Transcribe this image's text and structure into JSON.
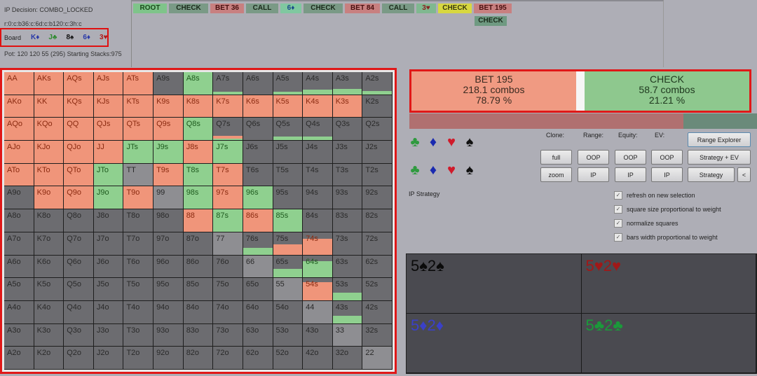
{
  "info": {
    "decision": "IP Decision:  COMBO_LOCKED",
    "line": "r:0:c:b36:c:6d:c:b120:c:3h:c",
    "pot": "Pot: 120 120 55 (295) Starting Stacks:975"
  },
  "board": {
    "label": "Board",
    "cards": [
      {
        "text": "K♦",
        "color": "#2a3aa8"
      },
      {
        "text": "J♣",
        "color": "#2e8a2e"
      },
      {
        "text": "8♠",
        "color": "#111111"
      },
      {
        "text": "6♦",
        "color": "#2a3aa8"
      },
      {
        "text": "3♥",
        "color": "#b01a1a"
      }
    ]
  },
  "tree": {
    "nodes": [
      {
        "label": "ROOT",
        "bg": "#7fc48a",
        "fg": "#1a4a1a"
      },
      {
        "label": "CHECK",
        "bg": "#7a9a86",
        "fg": "#1a2a1a"
      },
      {
        "label": "BET 36",
        "bg": "#c88080",
        "fg": "#4a1010"
      },
      {
        "label": "CALL",
        "bg": "#7a9a86",
        "fg": "#1a2a1a"
      },
      {
        "label": "6♦",
        "bg": "#80c8a0",
        "fg": "#1a4a8a"
      },
      {
        "label": "CHECK",
        "bg": "#7a9a86",
        "fg": "#1a2a1a"
      },
      {
        "label": "BET 84",
        "bg": "#c88080",
        "fg": "#4a1010"
      },
      {
        "label": "CALL",
        "bg": "#7a9a86",
        "fg": "#1a2a1a"
      },
      {
        "label": "3♥",
        "bg": "#80b890",
        "fg": "#8a2020"
      },
      {
        "label": "CHECK",
        "bg": "#d8d840",
        "fg": "#3a3a10"
      },
      {
        "label": "BET 195",
        "bg": "#c88080",
        "fg": "#4a1010"
      }
    ],
    "child": {
      "label": "CHECK",
      "bg": "#6f9a82",
      "fg": "#1a2a1a"
    }
  },
  "colors": {
    "bet": "#f0957a",
    "check": "#8fd08f",
    "empty": "#6c6c70",
    "pair_empty": "#8e8e92"
  },
  "grid": {
    "ranks": [
      "A",
      "K",
      "Q",
      "J",
      "T",
      "9",
      "8",
      "7",
      "6",
      "5",
      "4",
      "3",
      "2"
    ],
    "cells": [
      [
        {
          "h": "AA",
          "b": 1,
          "c": 0
        },
        {
          "h": "AKs",
          "b": 1,
          "c": 0
        },
        {
          "h": "AQs",
          "b": 1,
          "c": 0
        },
        {
          "h": "AJs",
          "b": 1,
          "c": 0
        },
        {
          "h": "ATs",
          "b": 1,
          "c": 0
        },
        {
          "h": "A9s",
          "b": 0,
          "c": 0
        },
        {
          "h": "A8s",
          "b": 0,
          "c": 1
        },
        {
          "h": "A7s",
          "b": 0,
          "c": 0.12
        },
        {
          "h": "A6s",
          "b": 0,
          "c": 0
        },
        {
          "h": "A5s",
          "b": 0,
          "c": 0.12
        },
        {
          "h": "A4s",
          "b": 0,
          "c": 0.2
        },
        {
          "h": "A3s",
          "b": 0,
          "c": 0.25
        },
        {
          "h": "A2s",
          "b": 0,
          "c": 0.15
        }
      ],
      [
        {
          "h": "AKo",
          "b": 1,
          "c": 0
        },
        {
          "h": "KK",
          "b": 1,
          "c": 0
        },
        {
          "h": "KQs",
          "b": 1,
          "c": 0
        },
        {
          "h": "KJs",
          "b": 1,
          "c": 0
        },
        {
          "h": "KTs",
          "b": 1,
          "c": 0
        },
        {
          "h": "K9s",
          "b": 1,
          "c": 0
        },
        {
          "h": "K8s",
          "b": 1,
          "c": 0
        },
        {
          "h": "K7s",
          "b": 1,
          "c": 0
        },
        {
          "h": "K6s",
          "b": 1,
          "c": 0
        },
        {
          "h": "K5s",
          "b": 1,
          "c": 0
        },
        {
          "h": "K4s",
          "b": 1,
          "c": 0
        },
        {
          "h": "K3s",
          "b": 1,
          "c": 0
        },
        {
          "h": "K2s",
          "b": 0,
          "c": 0
        }
      ],
      [
        {
          "h": "AQo",
          "b": 1,
          "c": 0
        },
        {
          "h": "KQo",
          "b": 1,
          "c": 0
        },
        {
          "h": "QQ",
          "b": 1,
          "c": 0
        },
        {
          "h": "QJs",
          "b": 1,
          "c": 0
        },
        {
          "h": "QTs",
          "b": 1,
          "c": 0
        },
        {
          "h": "Q9s",
          "b": 1,
          "c": 0
        },
        {
          "h": "Q8s",
          "b": 0,
          "c": 1
        },
        {
          "h": "Q7s",
          "b": 0.15,
          "c": 0.05
        },
        {
          "h": "Q6s",
          "b": 0,
          "c": 0
        },
        {
          "h": "Q5s",
          "b": 0,
          "c": 0.15
        },
        {
          "h": "Q4s",
          "b": 0,
          "c": 0.15
        },
        {
          "h": "Q3s",
          "b": 0,
          "c": 0
        },
        {
          "h": "Q2s",
          "b": 0,
          "c": 0
        }
      ],
      [
        {
          "h": "AJo",
          "b": 1,
          "c": 0
        },
        {
          "h": "KJo",
          "b": 1,
          "c": 0
        },
        {
          "h": "QJo",
          "b": 1,
          "c": 0
        },
        {
          "h": "JJ",
          "b": 1,
          "c": 0
        },
        {
          "h": "JTs",
          "b": 0,
          "c": 1
        },
        {
          "h": "J9s",
          "b": 0,
          "c": 1
        },
        {
          "h": "J8s",
          "b": 1,
          "c": 0
        },
        {
          "h": "J7s",
          "b": 0,
          "c": 1
        },
        {
          "h": "J6s",
          "b": 0,
          "c": 0
        },
        {
          "h": "J5s",
          "b": 0,
          "c": 0
        },
        {
          "h": "J4s",
          "b": 0,
          "c": 0
        },
        {
          "h": "J3s",
          "b": 0,
          "c": 0
        },
        {
          "h": "J2s",
          "b": 0,
          "c": 0
        }
      ],
      [
        {
          "h": "ATo",
          "b": 1,
          "c": 0
        },
        {
          "h": "KTo",
          "b": 1,
          "c": 0
        },
        {
          "h": "QTo",
          "b": 1,
          "c": 0
        },
        {
          "h": "JTo",
          "b": 0,
          "c": 1
        },
        {
          "h": "TT",
          "b": 0,
          "c": 0
        },
        {
          "h": "T9s",
          "b": 1,
          "c": 0
        },
        {
          "h": "T8s",
          "b": 0,
          "c": 1
        },
        {
          "h": "T7s",
          "b": 1,
          "c": 0
        },
        {
          "h": "T6s",
          "b": 0,
          "c": 0
        },
        {
          "h": "T5s",
          "b": 0,
          "c": 0
        },
        {
          "h": "T4s",
          "b": 0,
          "c": 0
        },
        {
          "h": "T3s",
          "b": 0,
          "c": 0
        },
        {
          "h": "T2s",
          "b": 0,
          "c": 0
        }
      ],
      [
        {
          "h": "A9o",
          "b": 0,
          "c": 0
        },
        {
          "h": "K9o",
          "b": 1,
          "c": 0
        },
        {
          "h": "Q9o",
          "b": 1,
          "c": 0
        },
        {
          "h": "J9o",
          "b": 0,
          "c": 1
        },
        {
          "h": "T9o",
          "b": 1,
          "c": 0
        },
        {
          "h": "99",
          "b": 0,
          "c": 0
        },
        {
          "h": "98s",
          "b": 0,
          "c": 1
        },
        {
          "h": "97s",
          "b": 1,
          "c": 0
        },
        {
          "h": "96s",
          "b": 0,
          "c": 1
        },
        {
          "h": "95s",
          "b": 0,
          "c": 0
        },
        {
          "h": "94s",
          "b": 0,
          "c": 0
        },
        {
          "h": "93s",
          "b": 0,
          "c": 0
        },
        {
          "h": "92s",
          "b": 0,
          "c": 0
        }
      ],
      [
        {
          "h": "A8o",
          "b": 0,
          "c": 0
        },
        {
          "h": "K8o",
          "b": 0,
          "c": 0
        },
        {
          "h": "Q8o",
          "b": 0,
          "c": 0
        },
        {
          "h": "J8o",
          "b": 0,
          "c": 0
        },
        {
          "h": "T8o",
          "b": 0,
          "c": 0
        },
        {
          "h": "98o",
          "b": 0,
          "c": 0
        },
        {
          "h": "88",
          "b": 1,
          "c": 0
        },
        {
          "h": "87s",
          "b": 0,
          "c": 1
        },
        {
          "h": "86s",
          "b": 1,
          "c": 0
        },
        {
          "h": "85s",
          "b": 0,
          "c": 1
        },
        {
          "h": "84s",
          "b": 0,
          "c": 0
        },
        {
          "h": "83s",
          "b": 0,
          "c": 0
        },
        {
          "h": "82s",
          "b": 0,
          "c": 0
        }
      ],
      [
        {
          "h": "A7o",
          "b": 0,
          "c": 0
        },
        {
          "h": "K7o",
          "b": 0,
          "c": 0
        },
        {
          "h": "Q7o",
          "b": 0,
          "c": 0
        },
        {
          "h": "J7o",
          "b": 0,
          "c": 0
        },
        {
          "h": "T7o",
          "b": 0,
          "c": 0
        },
        {
          "h": "97o",
          "b": 0,
          "c": 0
        },
        {
          "h": "87o",
          "b": 0,
          "c": 0
        },
        {
          "h": "77",
          "b": 0,
          "c": 0
        },
        {
          "h": "76s",
          "b": 0,
          "c": 0.3
        },
        {
          "h": "75s",
          "b": 0.45,
          "c": 0
        },
        {
          "h": "74s",
          "b": 0.72,
          "c": 0
        },
        {
          "h": "73s",
          "b": 0,
          "c": 0
        },
        {
          "h": "72s",
          "b": 0,
          "c": 0
        }
      ],
      [
        {
          "h": "A6o",
          "b": 0,
          "c": 0
        },
        {
          "h": "K6o",
          "b": 0,
          "c": 0
        },
        {
          "h": "Q6o",
          "b": 0,
          "c": 0
        },
        {
          "h": "J6o",
          "b": 0,
          "c": 0
        },
        {
          "h": "T6o",
          "b": 0,
          "c": 0
        },
        {
          "h": "96o",
          "b": 0,
          "c": 0
        },
        {
          "h": "86o",
          "b": 0,
          "c": 0
        },
        {
          "h": "76o",
          "b": 0,
          "c": 0
        },
        {
          "h": "66",
          "b": 0,
          "c": 0
        },
        {
          "h": "65s",
          "b": 0,
          "c": 0.38
        },
        {
          "h": "64s",
          "b": 0,
          "c": 0.72
        },
        {
          "h": "63s",
          "b": 0,
          "c": 0
        },
        {
          "h": "62s",
          "b": 0,
          "c": 0
        }
      ],
      [
        {
          "h": "A5o",
          "b": 0,
          "c": 0
        },
        {
          "h": "K5o",
          "b": 0,
          "c": 0
        },
        {
          "h": "Q5o",
          "b": 0,
          "c": 0
        },
        {
          "h": "J5o",
          "b": 0,
          "c": 0
        },
        {
          "h": "T5o",
          "b": 0,
          "c": 0
        },
        {
          "h": "95o",
          "b": 0,
          "c": 0
        },
        {
          "h": "85o",
          "b": 0,
          "c": 0
        },
        {
          "h": "75o",
          "b": 0,
          "c": 0
        },
        {
          "h": "65o",
          "b": 0,
          "c": 0
        },
        {
          "h": "55",
          "b": 0,
          "c": 0
        },
        {
          "h": "54s",
          "b": 0.82,
          "c": 0
        },
        {
          "h": "53s",
          "b": 0,
          "c": 0.35
        },
        {
          "h": "52s",
          "b": 0,
          "c": 0
        }
      ],
      [
        {
          "h": "A4o",
          "b": 0,
          "c": 0
        },
        {
          "h": "K4o",
          "b": 0,
          "c": 0
        },
        {
          "h": "Q4o",
          "b": 0,
          "c": 0
        },
        {
          "h": "J4o",
          "b": 0,
          "c": 0
        },
        {
          "h": "T4o",
          "b": 0,
          "c": 0
        },
        {
          "h": "94o",
          "b": 0,
          "c": 0
        },
        {
          "h": "84o",
          "b": 0,
          "c": 0
        },
        {
          "h": "74o",
          "b": 0,
          "c": 0
        },
        {
          "h": "64o",
          "b": 0,
          "c": 0
        },
        {
          "h": "54o",
          "b": 0,
          "c": 0
        },
        {
          "h": "44",
          "b": 0,
          "c": 0
        },
        {
          "h": "43s",
          "b": 0,
          "c": 0.35
        },
        {
          "h": "42s",
          "b": 0,
          "c": 0
        }
      ],
      [
        {
          "h": "A3o",
          "b": 0,
          "c": 0
        },
        {
          "h": "K3o",
          "b": 0,
          "c": 0
        },
        {
          "h": "Q3o",
          "b": 0,
          "c": 0
        },
        {
          "h": "J3o",
          "b": 0,
          "c": 0
        },
        {
          "h": "T3o",
          "b": 0,
          "c": 0
        },
        {
          "h": "93o",
          "b": 0,
          "c": 0
        },
        {
          "h": "83o",
          "b": 0,
          "c": 0
        },
        {
          "h": "73o",
          "b": 0,
          "c": 0
        },
        {
          "h": "63o",
          "b": 0,
          "c": 0
        },
        {
          "h": "53o",
          "b": 0,
          "c": 0
        },
        {
          "h": "43o",
          "b": 0,
          "c": 0
        },
        {
          "h": "33",
          "b": 0,
          "c": 0
        },
        {
          "h": "32s",
          "b": 0,
          "c": 0
        }
      ],
      [
        {
          "h": "A2o",
          "b": 0,
          "c": 0
        },
        {
          "h": "K2o",
          "b": 0,
          "c": 0
        },
        {
          "h": "Q2o",
          "b": 0,
          "c": 0
        },
        {
          "h": "J2o",
          "b": 0,
          "c": 0
        },
        {
          "h": "T2o",
          "b": 0,
          "c": 0
        },
        {
          "h": "92o",
          "b": 0,
          "c": 0
        },
        {
          "h": "82o",
          "b": 0,
          "c": 0
        },
        {
          "h": "72o",
          "b": 0,
          "c": 0
        },
        {
          "h": "62o",
          "b": 0,
          "c": 0
        },
        {
          "h": "52o",
          "b": 0,
          "c": 0
        },
        {
          "h": "42o",
          "b": 0,
          "c": 0
        },
        {
          "h": "32o",
          "b": 0,
          "c": 0
        },
        {
          "h": "22",
          "b": 0,
          "c": 0
        }
      ]
    ]
  },
  "summary": {
    "bet": {
      "title": "BET 195",
      "combos": "218.1 combos",
      "pct": "78.79 %"
    },
    "check": {
      "title": "CHECK",
      "combos": "58.7 combos",
      "pct": "21.21 %"
    },
    "bet_fraction": 0.7879
  },
  "suits": {
    "row1": [
      {
        "s": "♣",
        "color": "#2e9a3e"
      },
      {
        "s": "♦",
        "color": "#1a2ab0"
      },
      {
        "s": "♥",
        "color": "#d01a2a"
      },
      {
        "s": "♠",
        "color": "#111111"
      }
    ],
    "row2": [
      {
        "s": "♣",
        "color": "#2e9a3e"
      },
      {
        "s": "♦",
        "color": "#1a2ab0"
      },
      {
        "s": "♥",
        "color": "#d01a2a"
      },
      {
        "s": "♠",
        "color": "#111111"
      }
    ]
  },
  "controls": {
    "headers": {
      "clone": "Clone:",
      "range": "Range:",
      "equity": "Equity:",
      "ev": "EV:"
    },
    "range_explorer": "Range Explorer",
    "full": "full",
    "zoom": "zoom",
    "range_oop": "OOP",
    "range_ip": "IP",
    "equity_oop": "OOP",
    "equity_ip": "IP",
    "ev_oop": "OOP",
    "ev_ip": "IP",
    "strategy_ev": "Strategy + EV",
    "strategy": "Strategy",
    "collapse": "<"
  },
  "strategy_label": "IP Strategy",
  "options": [
    {
      "label": "refresh on new selection",
      "checked": true
    },
    {
      "label": "square size proportional to weight",
      "checked": true
    },
    {
      "label": "normalize squares",
      "checked": true
    },
    {
      "label": "bars width proportional to weight",
      "checked": true
    }
  ],
  "combos": [
    {
      "text": "5♠2♠",
      "color": "#0a0a0a"
    },
    {
      "text": "5♥2♥",
      "color": "#a01818"
    },
    {
      "text": "5♦2♦",
      "color": "#3a40c8"
    },
    {
      "text": "5♣2♣",
      "color": "#1a9a3a"
    }
  ]
}
